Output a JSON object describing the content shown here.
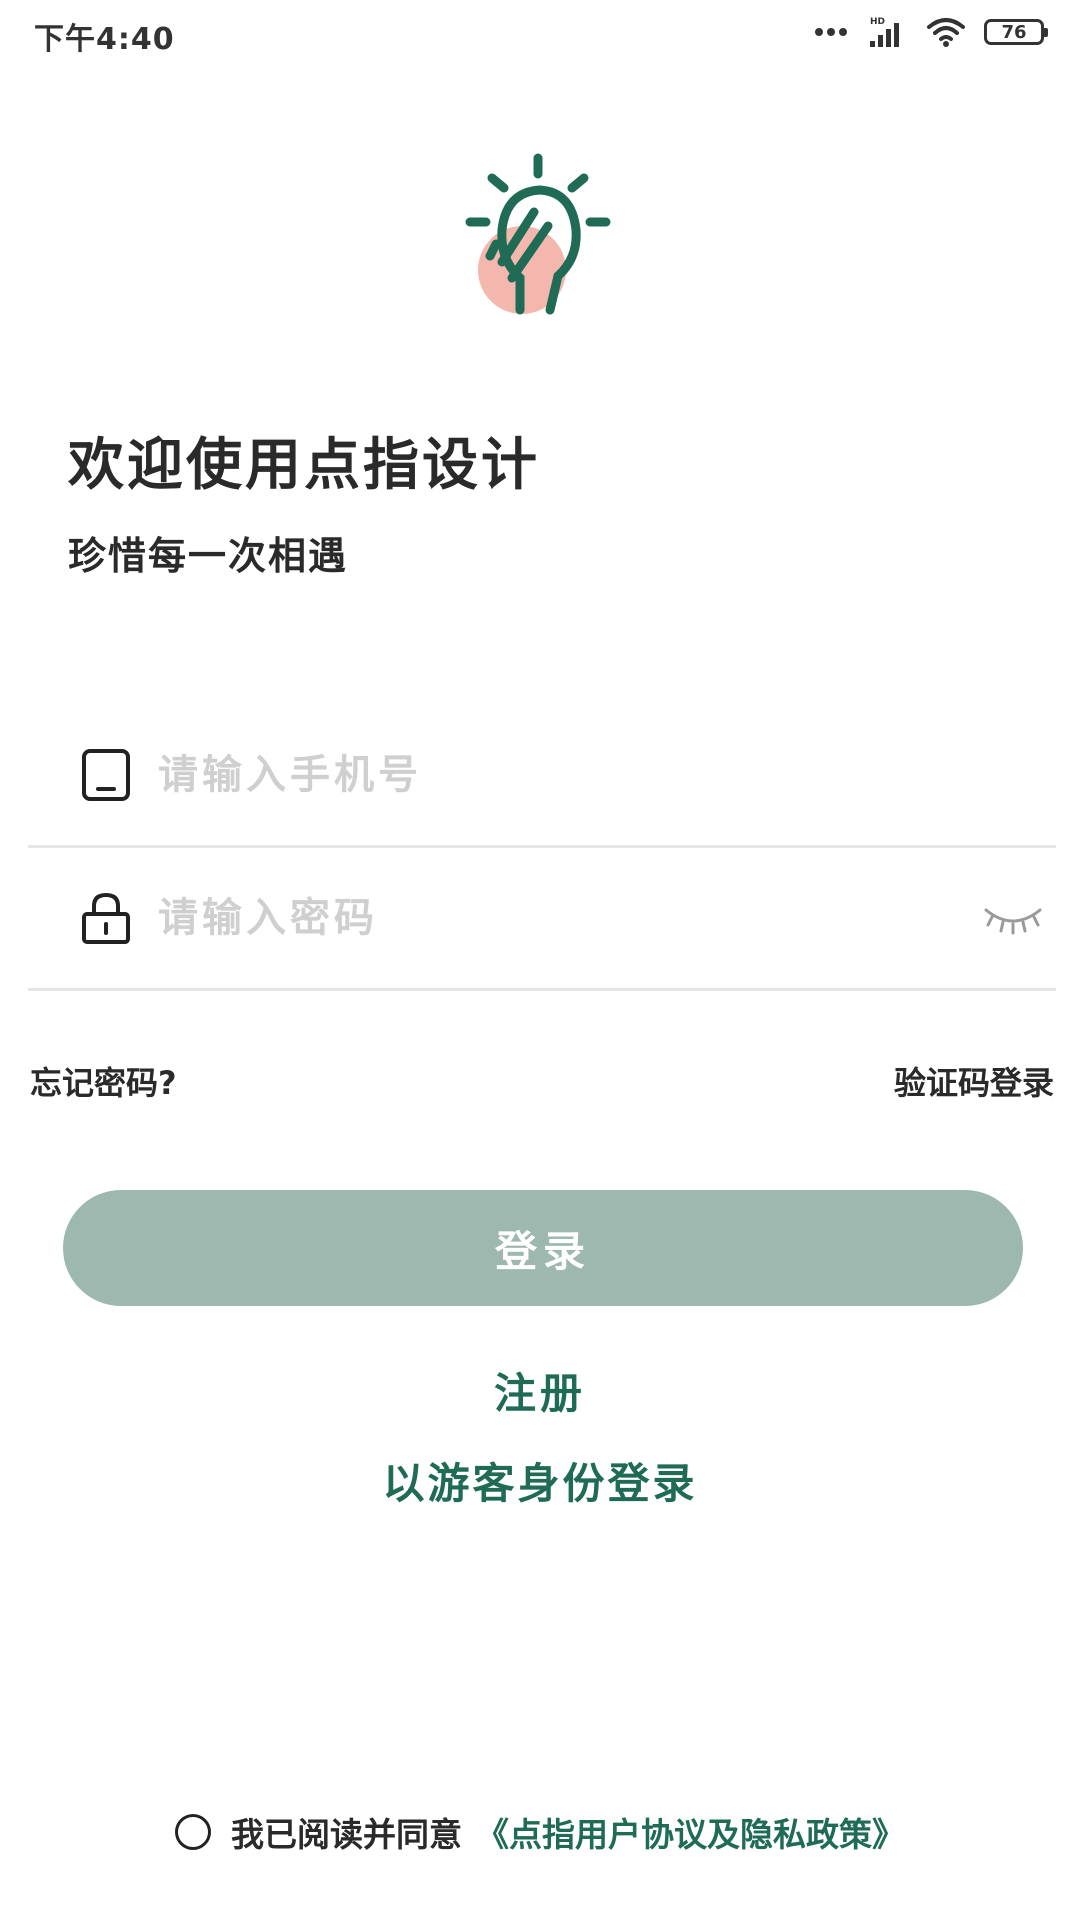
{
  "status_bar": {
    "time": "下午4:40",
    "battery": "76",
    "icons": [
      "more-dots-icon",
      "hd-signal-icon",
      "wifi-icon",
      "battery-icon"
    ]
  },
  "logo": {
    "icon": "lightbulb-hand-logo",
    "colors": {
      "primary": "#1f6b55",
      "accent": "#f3b7ad"
    }
  },
  "welcome": {
    "title": "欢迎使用点指设计",
    "subtitle": "珍惜每一次相遇"
  },
  "form": {
    "phone": {
      "placeholder": "请输入手机号",
      "value": "",
      "icon": "phone-icon"
    },
    "password": {
      "placeholder": "请输入密码",
      "value": "",
      "icon": "lock-icon",
      "toggle_icon": "eye-closed-icon"
    }
  },
  "links": {
    "forgot": "忘记密码?",
    "code_login": "验证码登录",
    "register": "注册",
    "guest_login": "以游客身份登录"
  },
  "login_button": {
    "label": "登录"
  },
  "agreement": {
    "text": "我已阅读并同意",
    "link": "《点指用户协议及隐私政策》"
  },
  "colors": {
    "brand": "#1f6b55",
    "button": "#9db8ae",
    "placeholder": "#cfcfcf",
    "divider": "#e6e6e6"
  }
}
